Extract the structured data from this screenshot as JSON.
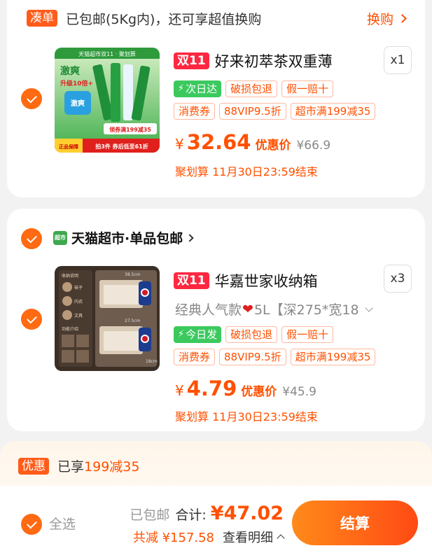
{
  "bundle_bar": {
    "badge": "凑单",
    "text": "已包邮(5Kg内)，还可享超值换购",
    "action": "换购"
  },
  "item1": {
    "badge": "双11",
    "title": "好来初萃茶双重薄",
    "qty": "x1",
    "tags_row1": [
      "次日达",
      "破损包退",
      "假一赔十"
    ],
    "tags_row2": [
      "消费券",
      "88VIP9.5折",
      "超市满199减35"
    ],
    "currency": "¥",
    "price": "32.64",
    "price_label": "优惠价",
    "original_price": "¥66.9",
    "deadline": "聚划算 11月30日23:59结束",
    "thumb": {
      "header": "天猫超市双11 · 聚划算",
      "promo": "激爽",
      "sub": "升级10倍+",
      "coupon": "领券满199减35",
      "deal": "拍3件 券后低至61折",
      "guarantee": "正品保障"
    }
  },
  "store": {
    "icon": "超市",
    "name": "天猫超市·单品包邮"
  },
  "item2": {
    "badge": "双11",
    "title": "华嘉世家收纳箱",
    "qty": "x3",
    "spec_pre": "经典人气款",
    "spec_post": "5L【深275*宽18",
    "tags_row1": [
      "今日发",
      "破损包退",
      "假一赔十"
    ],
    "tags_row2": [
      "消费券",
      "88VIP9.5折",
      "超市满199减35"
    ],
    "currency": "¥",
    "price": "4.79",
    "price_label": "优惠价",
    "original_price": "¥45.9",
    "deadline": "聚划算 11月30日23:59结束",
    "thumb": {
      "labels": [
        "收纳说明",
        "袜子",
        "内衣",
        "文具",
        "功能介绍"
      ],
      "dims": [
        "27.5cm",
        "38.5cm",
        "18cm"
      ]
    }
  },
  "promo": {
    "badge": "优惠",
    "text_pre": "已享",
    "text_amount": "199减35"
  },
  "footer": {
    "select_all": "全选",
    "shipping": "已包邮",
    "total_label": "合计:",
    "total": "¥47.02",
    "saved": "共减 ¥157.58",
    "detail": "查看明细",
    "checkout": "结算"
  },
  "colors": {
    "accent": "#ff5000",
    "badge_red": "#ff2740",
    "green": "#3bc95e"
  }
}
